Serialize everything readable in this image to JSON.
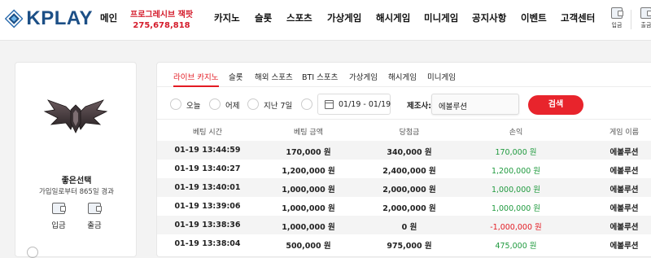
{
  "logo": {
    "text": "KPLAY"
  },
  "nav": {
    "items": [
      "메인",
      "카지노",
      "슬롯",
      "스포츠",
      "가상게임",
      "해시게임",
      "미니게임",
      "공지사항",
      "이벤트",
      "고객센터"
    ],
    "special": {
      "line1": "프로그레시브 잭팟",
      "line2": "275,678,818"
    }
  },
  "header_buttons": {
    "deposit": "입금",
    "withdraw": "출금"
  },
  "profile": {
    "nickname": "좋은선택",
    "since": "가입일로부터 865일 경과",
    "deposit": "입금",
    "withdraw": "출금"
  },
  "tabs": [
    "라이브 카지노",
    "슬롯",
    "해외 스포츠",
    "BTI 스포츠",
    "가상게임",
    "해시게임",
    "미니게임"
  ],
  "filters": {
    "radios": [
      "오늘",
      "어제",
      "지난 7일"
    ],
    "date_range": "01/19 - 01/19",
    "provider_label": "제조사:",
    "provider_value": "에볼루션",
    "search_label": "검색"
  },
  "table": {
    "headers": [
      "베팅 시간",
      "베팅 금액",
      "당첨금",
      "손익",
      "게임 이름"
    ],
    "rows": [
      {
        "time": "01-19 13:44:59",
        "bet": "170,000 원",
        "win": "340,000 원",
        "pl": "170,000 원",
        "pl_sign": "pos",
        "game": "에볼루션"
      },
      {
        "time": "01-19 13:40:27",
        "bet": "1,200,000 원",
        "win": "2,400,000 원",
        "pl": "1,200,000 원",
        "pl_sign": "pos",
        "game": "에볼루션"
      },
      {
        "time": "01-19 13:40:01",
        "bet": "1,000,000 원",
        "win": "2,000,000 원",
        "pl": "1,000,000 원",
        "pl_sign": "pos",
        "game": "에볼루션"
      },
      {
        "time": "01-19 13:39:06",
        "bet": "1,000,000 원",
        "win": "2,000,000 원",
        "pl": "1,000,000 원",
        "pl_sign": "pos",
        "game": "에볼루션"
      },
      {
        "time": "01-19 13:38:36",
        "bet": "1,000,000 원",
        "win": "0 원",
        "pl": "-1,000,000 원",
        "pl_sign": "neg",
        "game": "에볼루션"
      },
      {
        "time": "01-19 13:38:04",
        "bet": "500,000 원",
        "win": "975,000 원",
        "pl": "475,000 원",
        "pl_sign": "pos",
        "game": "에볼루션"
      }
    ]
  },
  "colors": {
    "brand": "#1c4f86",
    "accent": "#e31b23",
    "positive": "#1f9a3e",
    "negative": "#e31b23"
  }
}
